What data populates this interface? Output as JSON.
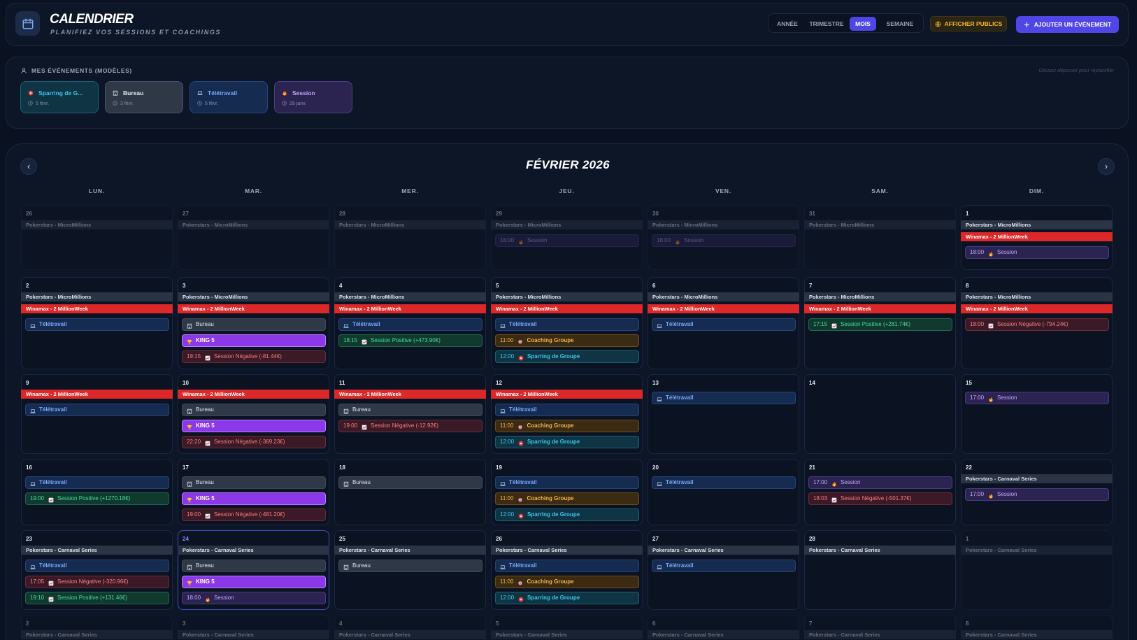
{
  "header": {
    "title": "CALENDRIER",
    "subtitle": "PLANIFIEZ VOS SESSIONS ET COACHINGS",
    "views": [
      {
        "label": "ANNÉE",
        "active": false
      },
      {
        "label": "TRIMESTRE",
        "active": false
      },
      {
        "label": "MOIS",
        "active": true
      },
      {
        "label": "SEMAINE",
        "active": false
      }
    ],
    "public_button": "AFFICHER PUBLICS",
    "add_button": "AJOUTER UN ÉVÉNEMENT"
  },
  "templates": {
    "title": "MES ÉVÉNEMENTS (MODÈLES)",
    "hint": "Glissez-déposez pour replanifier",
    "items": [
      {
        "name": "Sparring de G...",
        "date": "5 févr.",
        "kind": "spar",
        "icon": "red-dot-icon"
      },
      {
        "name": "Bureau",
        "date": "3 févr.",
        "kind": "bureau",
        "icon": "building-icon"
      },
      {
        "name": "Télétravail",
        "date": "5 févr.",
        "kind": "tele",
        "icon": "laptop-icon"
      },
      {
        "name": "Session",
        "date": "29 janv.",
        "kind": "session",
        "icon": "fire-icon"
      }
    ]
  },
  "calendar": {
    "month_title": "FÉVRIER 2026",
    "prev_label": "‹",
    "next_label": "›",
    "weekdays": [
      "LUN.",
      "MAR.",
      "MER.",
      "JEU.",
      "VEN.",
      "SAM.",
      "DIM."
    ],
    "colors": {
      "accent": "#5046e5",
      "winamax": "#dc2828",
      "pokerstars": "#2a3445"
    },
    "days": [
      {
        "n": "26",
        "other": true,
        "bars": [
          {
            "t": "Pokerstars - MicroMillions",
            "k": "ps"
          }
        ],
        "events": []
      },
      {
        "n": "27",
        "other": true,
        "bars": [
          {
            "t": "Pokerstars - MicroMillions",
            "k": "ps"
          }
        ],
        "events": []
      },
      {
        "n": "28",
        "other": true,
        "bars": [
          {
            "t": "Pokerstars - MicroMillions",
            "k": "ps"
          }
        ],
        "events": []
      },
      {
        "n": "29",
        "other": true,
        "bars": [
          {
            "t": "Pokerstars - MicroMillions",
            "k": "ps"
          }
        ],
        "events": [
          {
            "time": "18:00",
            "label": "Session",
            "k": "session"
          }
        ]
      },
      {
        "n": "30",
        "other": true,
        "bars": [
          {
            "t": "Pokerstars - MicroMillions",
            "k": "ps"
          }
        ],
        "events": [
          {
            "time": "18:00",
            "label": "Session",
            "k": "session"
          }
        ]
      },
      {
        "n": "31",
        "other": true,
        "bars": [
          {
            "t": "Pokerstars - MicroMillions",
            "k": "ps"
          }
        ],
        "events": []
      },
      {
        "n": "1",
        "bars": [
          {
            "t": "Pokerstars - MicroMillions",
            "k": "ps"
          },
          {
            "t": "Winamax - 2 MillionWeek",
            "k": "wn"
          }
        ],
        "events": [
          {
            "time": "18:00",
            "label": "Session",
            "k": "session"
          }
        ]
      },
      {
        "n": "2",
        "bars": [
          {
            "t": "Pokerstars - MicroMillions",
            "k": "ps"
          },
          {
            "t": "Winamax - 2 MillionWeek",
            "k": "wn"
          }
        ],
        "events": [
          {
            "time": "",
            "label": "Télétravail",
            "k": "tele"
          }
        ]
      },
      {
        "n": "3",
        "bars": [
          {
            "t": "Pokerstars - MicroMillions",
            "k": "ps"
          },
          {
            "t": "Winamax - 2 MillionWeek",
            "k": "wn"
          }
        ],
        "events": [
          {
            "time": "",
            "label": "Bureau",
            "k": "bureau"
          },
          {
            "time": "",
            "label": "KING 5",
            "k": "king"
          },
          {
            "time": "19:15",
            "label": "Session Négative (-81.44€)",
            "k": "neg"
          }
        ]
      },
      {
        "n": "4",
        "bars": [
          {
            "t": "Pokerstars - MicroMillions",
            "k": "ps"
          },
          {
            "t": "Winamax - 2 MillionWeek",
            "k": "wn"
          }
        ],
        "events": [
          {
            "time": "",
            "label": "Télétravail",
            "k": "tele"
          },
          {
            "time": "18:15",
            "label": "Session Positive (+473.90€)",
            "k": "pos"
          }
        ]
      },
      {
        "n": "5",
        "bars": [
          {
            "t": "Pokerstars - MicroMillions",
            "k": "ps"
          },
          {
            "t": "Winamax - 2 MillionWeek",
            "k": "wn"
          }
        ],
        "events": [
          {
            "time": "",
            "label": "Télétravail",
            "k": "tele"
          },
          {
            "time": "11:00",
            "label": "Coaching Groupe",
            "k": "coach"
          },
          {
            "time": "12:00",
            "label": "Sparring de Groupe",
            "k": "spar"
          }
        ]
      },
      {
        "n": "6",
        "bars": [
          {
            "t": "Pokerstars - MicroMillions",
            "k": "ps"
          },
          {
            "t": "Winamax - 2 MillionWeek",
            "k": "wn"
          }
        ],
        "events": [
          {
            "time": "",
            "label": "Télétravail",
            "k": "tele"
          }
        ]
      },
      {
        "n": "7",
        "bars": [
          {
            "t": "Pokerstars - MicroMillions",
            "k": "ps"
          },
          {
            "t": "Winamax - 2 MillionWeek",
            "k": "wn"
          }
        ],
        "events": [
          {
            "time": "17:15",
            "label": "Session Positive (+281.74€)",
            "k": "pos"
          }
        ]
      },
      {
        "n": "8",
        "bars": [
          {
            "t": "Pokerstars - MicroMillions",
            "k": "ps"
          },
          {
            "t": "Winamax - 2 MillionWeek",
            "k": "wn"
          }
        ],
        "events": [
          {
            "time": "18:00",
            "label": "Session Négative (-794.24€)",
            "k": "neg"
          }
        ]
      },
      {
        "n": "9",
        "bars": [
          {
            "t": "Winamax - 2 MillionWeek",
            "k": "wn"
          }
        ],
        "events": [
          {
            "time": "",
            "label": "Télétravail",
            "k": "tele"
          }
        ]
      },
      {
        "n": "10",
        "bars": [
          {
            "t": "Winamax - 2 MillionWeek",
            "k": "wn"
          }
        ],
        "events": [
          {
            "time": "",
            "label": "Bureau",
            "k": "bureau"
          },
          {
            "time": "",
            "label": "KING 5",
            "k": "king"
          },
          {
            "time": "22:20",
            "label": "Session Négative (-369.23€)",
            "k": "neg"
          }
        ]
      },
      {
        "n": "11",
        "bars": [
          {
            "t": "Winamax - 2 MillionWeek",
            "k": "wn"
          }
        ],
        "events": [
          {
            "time": "",
            "label": "Bureau",
            "k": "bureau"
          },
          {
            "time": "19:00",
            "label": "Session Négative (-12.92€)",
            "k": "neg"
          }
        ]
      },
      {
        "n": "12",
        "bars": [
          {
            "t": "Winamax - 2 MillionWeek",
            "k": "wn"
          }
        ],
        "events": [
          {
            "time": "",
            "label": "Télétravail",
            "k": "tele"
          },
          {
            "time": "11:00",
            "label": "Coaching Groupe",
            "k": "coach"
          },
          {
            "time": "12:00",
            "label": "Sparring de Groupe",
            "k": "spar"
          }
        ]
      },
      {
        "n": "13",
        "bars": [],
        "events": [
          {
            "time": "",
            "label": "Télétravail",
            "k": "tele"
          }
        ]
      },
      {
        "n": "14",
        "bars": [],
        "events": []
      },
      {
        "n": "15",
        "bars": [],
        "events": [
          {
            "time": "17:00",
            "label": "Session",
            "k": "session"
          }
        ]
      },
      {
        "n": "16",
        "bars": [],
        "events": [
          {
            "time": "",
            "label": "Télétravail",
            "k": "tele"
          },
          {
            "time": "19:00",
            "label": "Session Positive (+1270.18€)",
            "k": "pos"
          }
        ]
      },
      {
        "n": "17",
        "bars": [],
        "events": [
          {
            "time": "",
            "label": "Bureau",
            "k": "bureau"
          },
          {
            "time": "",
            "label": "KING 5",
            "k": "king"
          },
          {
            "time": "19:00",
            "label": "Session Négative (-481.20€)",
            "k": "neg"
          }
        ]
      },
      {
        "n": "18",
        "bars": [],
        "events": [
          {
            "time": "",
            "label": "Bureau",
            "k": "bureau"
          }
        ]
      },
      {
        "n": "19",
        "bars": [],
        "events": [
          {
            "time": "",
            "label": "Télétravail",
            "k": "tele"
          },
          {
            "time": "11:00",
            "label": "Coaching Groupe",
            "k": "coach"
          },
          {
            "time": "12:00",
            "label": "Sparring de Groupe",
            "k": "spar"
          }
        ]
      },
      {
        "n": "20",
        "bars": [],
        "events": [
          {
            "time": "",
            "label": "Télétravail",
            "k": "tele"
          }
        ]
      },
      {
        "n": "21",
        "bars": [],
        "events": [
          {
            "time": "17:00",
            "label": "Session",
            "k": "session"
          },
          {
            "time": "18:03",
            "label": "Session Négative (-501.37€)",
            "k": "neg"
          }
        ]
      },
      {
        "n": "22",
        "bars": [
          {
            "t": "Pokerstars - Carnaval Series",
            "k": "ps"
          }
        ],
        "events": [
          {
            "time": "17:00",
            "label": "Session",
            "k": "session"
          }
        ]
      },
      {
        "n": "23",
        "bars": [
          {
            "t": "Pokerstars - Carnaval Series",
            "k": "ps"
          }
        ],
        "events": [
          {
            "time": "",
            "label": "Télétravail",
            "k": "tele"
          },
          {
            "time": "17:05",
            "label": "Session Négative (-320.96€)",
            "k": "neg"
          },
          {
            "time": "19:10",
            "label": "Session Positive (+131.46€)",
            "k": "pos"
          }
        ]
      },
      {
        "n": "24",
        "today": true,
        "bars": [
          {
            "t": "Pokerstars - Carnaval Series",
            "k": "ps"
          }
        ],
        "events": [
          {
            "time": "",
            "label": "Bureau",
            "k": "bureau"
          },
          {
            "time": "",
            "label": "KING 5",
            "k": "king"
          },
          {
            "time": "18:00",
            "label": "Session",
            "k": "session"
          }
        ]
      },
      {
        "n": "25",
        "bars": [
          {
            "t": "Pokerstars - Carnaval Series",
            "k": "ps"
          }
        ],
        "events": [
          {
            "time": "",
            "label": "Bureau",
            "k": "bureau"
          }
        ]
      },
      {
        "n": "26",
        "bars": [
          {
            "t": "Pokerstars - Carnaval Series",
            "k": "ps"
          }
        ],
        "events": [
          {
            "time": "",
            "label": "Télétravail",
            "k": "tele"
          },
          {
            "time": "11:00",
            "label": "Coaching Groupe",
            "k": "coach"
          },
          {
            "time": "12:00",
            "label": "Sparring de Groupe",
            "k": "spar"
          }
        ]
      },
      {
        "n": "27",
        "bars": [
          {
            "t": "Pokerstars - Carnaval Series",
            "k": "ps"
          }
        ],
        "events": [
          {
            "time": "",
            "label": "Télétravail",
            "k": "tele"
          }
        ]
      },
      {
        "n": "28",
        "bars": [
          {
            "t": "Pokerstars - Carnaval Series",
            "k": "ps"
          }
        ],
        "events": []
      },
      {
        "n": "1",
        "other": true,
        "bars": [
          {
            "t": "Pokerstars - Carnaval Series",
            "k": "ps"
          }
        ],
        "events": []
      },
      {
        "n": "2",
        "other": true,
        "bars": [
          {
            "t": "Pokerstars - Carnaval Series",
            "k": "ps"
          }
        ],
        "events": []
      },
      {
        "n": "3",
        "other": true,
        "bars": [
          {
            "t": "Pokerstars - Carnaval Series",
            "k": "ps"
          }
        ],
        "events": []
      },
      {
        "n": "4",
        "other": true,
        "bars": [
          {
            "t": "Pokerstars - Carnaval Series",
            "k": "ps"
          }
        ],
        "events": []
      },
      {
        "n": "5",
        "other": true,
        "bars": [
          {
            "t": "Pokerstars - Carnaval Series",
            "k": "ps"
          }
        ],
        "events": []
      },
      {
        "n": "6",
        "other": true,
        "bars": [
          {
            "t": "Pokerstars - Carnaval Series",
            "k": "ps"
          }
        ],
        "events": []
      },
      {
        "n": "7",
        "other": true,
        "bars": [
          {
            "t": "Pokerstars - Carnaval Series",
            "k": "ps"
          }
        ],
        "events": []
      },
      {
        "n": "8",
        "other": true,
        "bars": [
          {
            "t": "Pokerstars - Carnaval Series",
            "k": "ps"
          }
        ],
        "events": []
      }
    ]
  }
}
